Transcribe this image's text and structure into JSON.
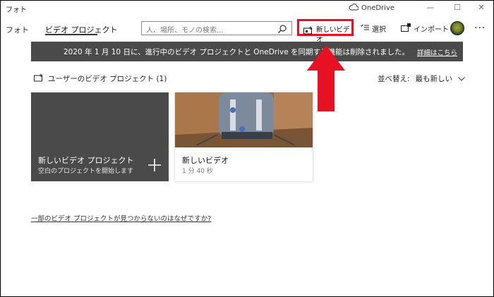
{
  "window": {
    "title": "フォト",
    "onedrive_label": "OneDrive",
    "controls": [
      "—",
      "☐",
      "✕"
    ]
  },
  "nav": {
    "tabs": [
      {
        "label": "フォト",
        "active": false
      },
      {
        "label": "ビデオ プロジェクト",
        "active": true
      }
    ],
    "search_placeholder": "人、場所、モノの検索..."
  },
  "commands": {
    "new_video": "新しいビデオ",
    "select": "選択",
    "import": "インポート",
    "more": "..."
  },
  "banner": {
    "message": "2020 年 1 月 10 日に、進行中のビデオ プロジェクトと OneDrive を同期する機能は削除されました。",
    "link": "詳細はこちら"
  },
  "projects": {
    "heading": "ユーザーのビデオ プロジェクト (1)",
    "sort_label": "並べ替え:",
    "sort_value": "最も新しい",
    "new_card": {
      "title": "新しいビデオ プロジェクト",
      "subtitle": "空白のプロジェクトを開始します"
    },
    "items": [
      {
        "title": "新しいビデオ",
        "duration": "1 分 40 秒"
      }
    ]
  },
  "help_link": "一部のビデオ プロジェクトが見つからないのはなぜですか?",
  "colors": {
    "highlight": "#e81123",
    "banner_bg": "#4a4a4a"
  }
}
